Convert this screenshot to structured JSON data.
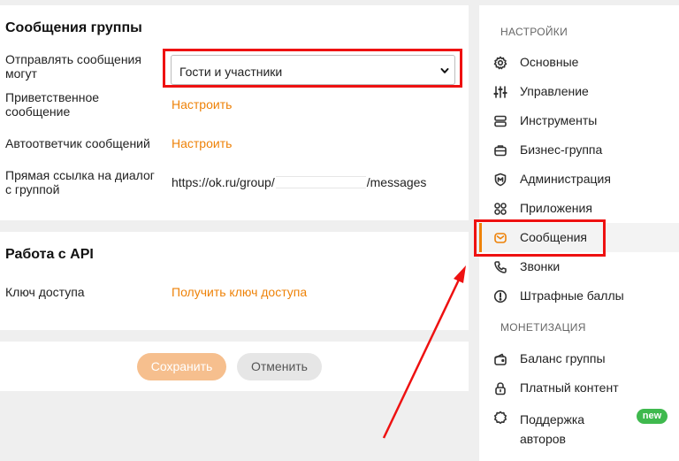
{
  "messages_section": {
    "title": "Сообщения группы",
    "send_label": "Отправлять сообщения могут",
    "send_value": "Гости и участники",
    "welcome_label": "Приветственное сообщение",
    "welcome_link": "Настроить",
    "autoreply_label": "Автоответчик сообщений",
    "autoreply_link": "Настроить",
    "direct_link_label": "Прямая ссылка на диалог с группой",
    "direct_link_prefix": "https://ok.ru/group/",
    "direct_link_suffix": "/messages"
  },
  "api_section": {
    "title": "Работа с API",
    "key_label": "Ключ доступа",
    "key_link": "Получить ключ доступа"
  },
  "actions": {
    "save": "Сохранить",
    "cancel": "Отменить"
  },
  "sidebar": {
    "settings_header": "НАСТРОЙКИ",
    "items": [
      {
        "label": "Основные",
        "icon": "gear-icon"
      },
      {
        "label": "Управление",
        "icon": "sliders-icon"
      },
      {
        "label": "Инструменты",
        "icon": "tools-icon"
      },
      {
        "label": "Бизнес-группа",
        "icon": "briefcase-icon"
      },
      {
        "label": "Администрация",
        "icon": "shield-icon"
      },
      {
        "label": "Приложения",
        "icon": "apps-icon"
      },
      {
        "label": "Сообщения",
        "icon": "mail-icon",
        "active": true
      },
      {
        "label": "Звонки",
        "icon": "phone-icon"
      },
      {
        "label": "Штрафные баллы",
        "icon": "warning-icon"
      }
    ],
    "monetization_header": "МОНЕТИЗАЦИЯ",
    "monetization_items": [
      {
        "label": "Баланс группы",
        "icon": "wallet-icon"
      },
      {
        "label": "Платный контент",
        "icon": "lock-icon"
      },
      {
        "label": "Поддержка авторов",
        "icon": "badge-icon",
        "badge": "new"
      }
    ]
  },
  "colors": {
    "accent": "#ee8208",
    "save_disabled": "#f6bf8e",
    "highlight": "#e11111",
    "new_badge": "#3fb94e"
  }
}
